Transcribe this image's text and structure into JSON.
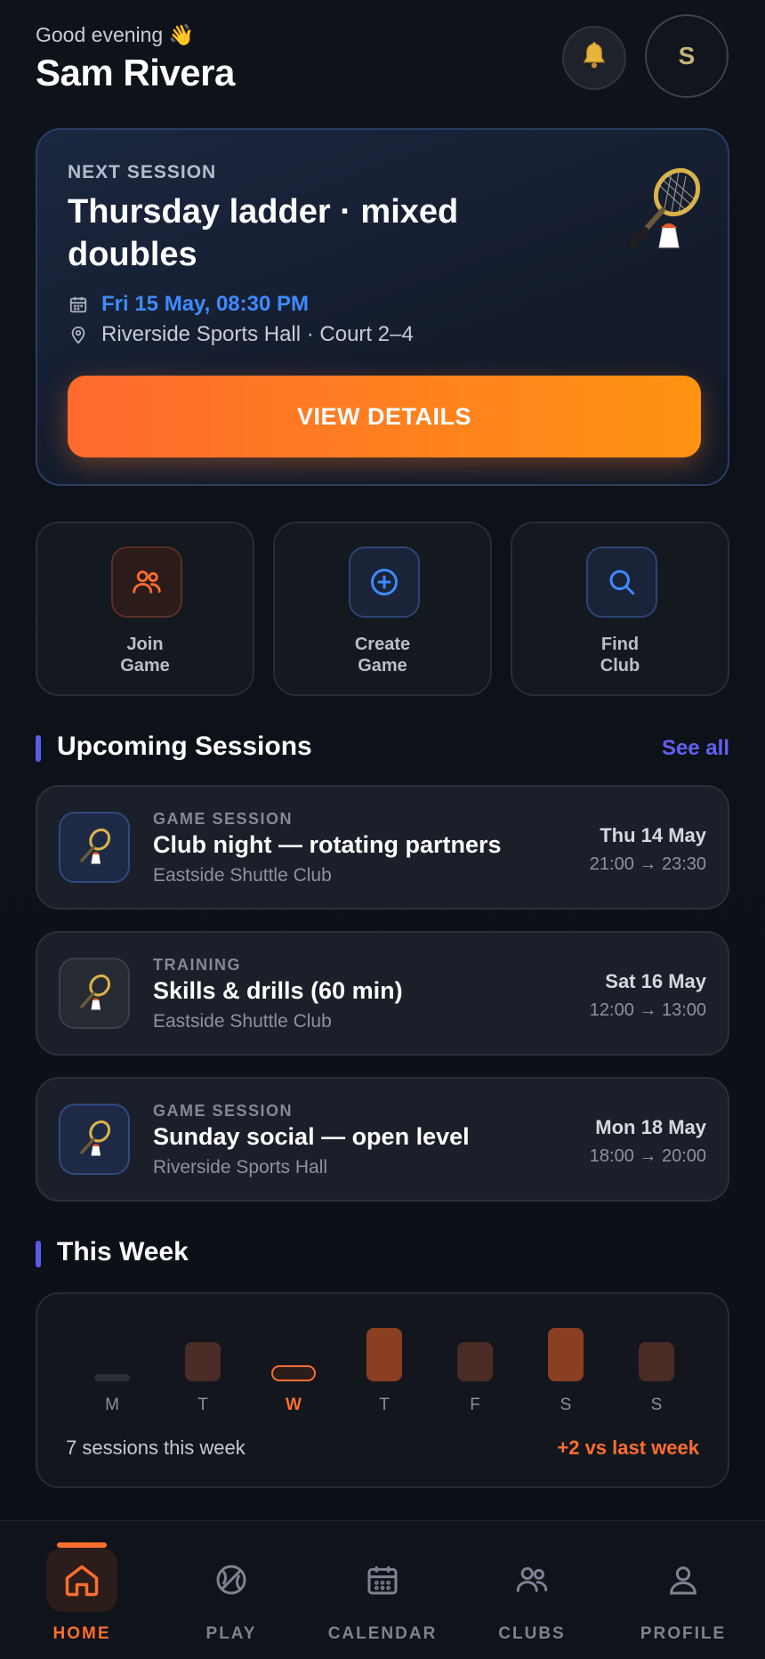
{
  "header": {
    "greeting": "Good evening 👋",
    "user_name": "Sam Rivera",
    "avatar_initial": "S"
  },
  "next_session": {
    "label": "NEXT SESSION",
    "title": "Thursday ladder · mixed doubles",
    "datetime": "Fri 15 May, 08:30 PM",
    "location": "Riverside Sports Hall · Court 2–4",
    "button_label": "VIEW DETAILS"
  },
  "quick_actions": [
    {
      "label": "Join\nGame",
      "icon": "users-icon"
    },
    {
      "label": "Create\nGame",
      "icon": "plus-circle-icon"
    },
    {
      "label": "Find\nClub",
      "icon": "search-icon"
    }
  ],
  "upcoming": {
    "title": "Upcoming Sessions",
    "see_all": "See all",
    "items": [
      {
        "type": "GAME SESSION",
        "name": "Club night — rotating partners",
        "club": "Eastside Shuttle Club",
        "day": "Thu 14 May",
        "time": "21:00 → 23:30"
      },
      {
        "type": "TRAINING",
        "name": "Skills & drills (60 min)",
        "club": "Eastside Shuttle Club",
        "day": "Sat 16 May",
        "time": "12:00 → 13:00"
      },
      {
        "type": "GAME SESSION",
        "name": "Sunday social — open level",
        "club": "Riverside Sports Hall",
        "day": "Mon 18 May",
        "time": "18:00 → 20:00"
      }
    ]
  },
  "this_week": {
    "title": "This Week",
    "days": [
      "M",
      "T",
      "W",
      "T",
      "F",
      "S",
      "S"
    ],
    "sessions_per_day": [
      0,
      1,
      0,
      2,
      1,
      2,
      1
    ],
    "today_index": 2,
    "summary": "7 sessions this week",
    "delta": "+2 vs last week"
  },
  "bottom_nav": {
    "items": [
      "HOME",
      "PLAY",
      "CALENDAR",
      "CLUBS",
      "PROFILE"
    ],
    "active": "HOME"
  },
  "colors": {
    "accent_orange": "#ff6d2e",
    "accent_blue": "#3d8bff",
    "accent_indigo": "#5b5bf0"
  }
}
